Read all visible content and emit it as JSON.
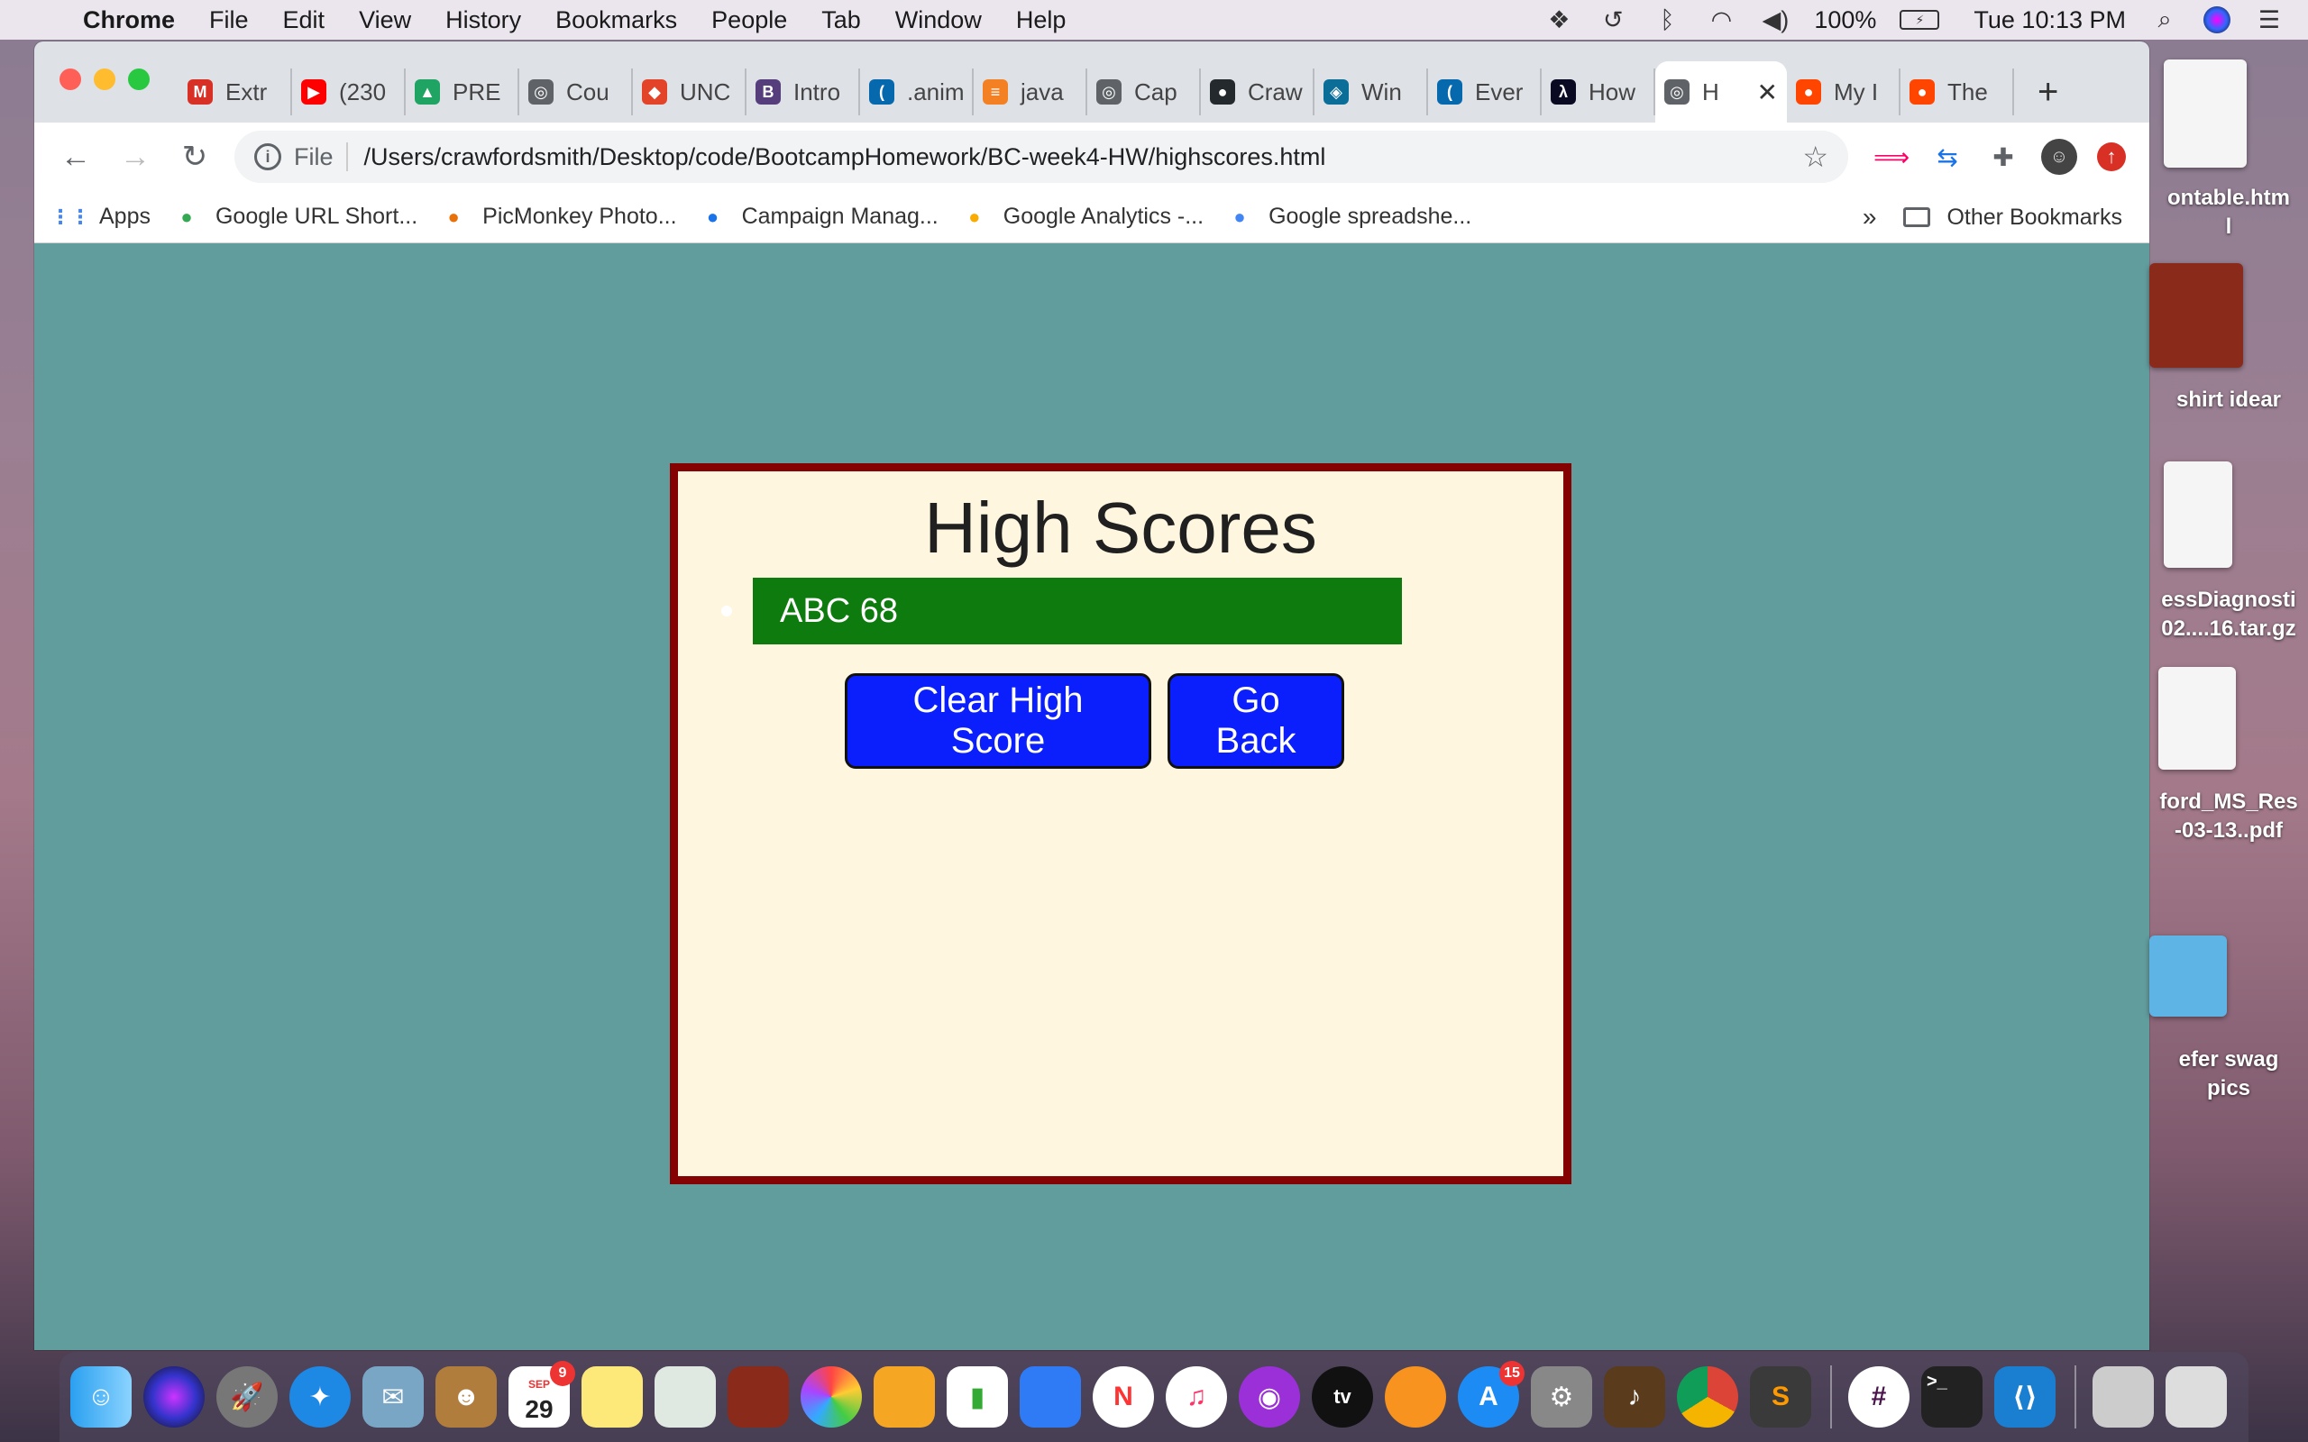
{
  "menubar": {
    "app": "Chrome",
    "items": [
      "File",
      "Edit",
      "View",
      "History",
      "Bookmarks",
      "People",
      "Tab",
      "Window",
      "Help"
    ],
    "battery": "100%",
    "clock": "Tue 10:13 PM"
  },
  "tabs": [
    {
      "label": "Extr",
      "icon": "gmail-icon",
      "color": "#d93025",
      "glyph": "M"
    },
    {
      "label": "(230",
      "icon": "youtube-icon",
      "color": "#ff0000",
      "glyph": "▶"
    },
    {
      "label": "PRE",
      "icon": "google-drive-icon",
      "color": "#1fa463",
      "glyph": "▲"
    },
    {
      "label": "Cou",
      "icon": "globe-icon",
      "color": "#5f6368",
      "glyph": "◎"
    },
    {
      "label": "UNC",
      "icon": "gitlab-icon",
      "color": "#e24329",
      "glyph": "◆"
    },
    {
      "label": "Intro",
      "icon": "bootstrap-icon",
      "color": "#563d7c",
      "glyph": "B"
    },
    {
      "label": ".anim",
      "icon": "jquery-icon",
      "color": "#0769ad",
      "glyph": "("
    },
    {
      "label": "java",
      "icon": "stackoverflow-icon",
      "color": "#f48024",
      "glyph": "≡"
    },
    {
      "label": "Cap",
      "icon": "globe-icon",
      "color": "#5f6368",
      "glyph": "◎"
    },
    {
      "label": "Craw",
      "icon": "github-icon",
      "color": "#24292e",
      "glyph": "●"
    },
    {
      "label": "Win",
      "icon": "site-icon",
      "color": "#0b6e99",
      "glyph": "◈"
    },
    {
      "label": "Ever",
      "icon": "jquery-icon",
      "color": "#0769ad",
      "glyph": "("
    },
    {
      "label": "How",
      "icon": "freecodecamp-icon",
      "color": "#0a0a23",
      "glyph": "λ"
    },
    {
      "label": "H",
      "icon": "globe-icon",
      "color": "#5f6368",
      "glyph": "◎",
      "active": true
    },
    {
      "label": "My I",
      "icon": "reddit-icon",
      "color": "#ff4500",
      "glyph": "●"
    },
    {
      "label": "The",
      "icon": "reddit-icon",
      "color": "#ff4500",
      "glyph": "●"
    }
  ],
  "address": {
    "scheme_label": "File",
    "url": "/Users/crawfordsmith/Desktop/code/BootcampHomework/BC-week4-HW/highscores.html"
  },
  "bookmarks": [
    {
      "label": "Apps",
      "icon": "apps-grid-icon"
    },
    {
      "label": "Google URL Short...",
      "icon": "url-shortener-icon"
    },
    {
      "label": "PicMonkey Photo...",
      "icon": "picmonkey-icon"
    },
    {
      "label": "Campaign Manag...",
      "icon": "google-ads-icon"
    },
    {
      "label": "Google Analytics -...",
      "icon": "analytics-icon"
    },
    {
      "label": "Google spreadshe...",
      "icon": "google-icon"
    }
  ],
  "bookmarks_more": "»",
  "other_bookmarks": "Other Bookmarks",
  "page": {
    "title": "High Scores",
    "scores": [
      "ABC 68"
    ],
    "clear_button": "Clear High Score",
    "back_button": "Go Back",
    "colors": {
      "background": "#629d9e",
      "card": "#fef6de",
      "card_border": "#850202",
      "score_row": "#0e7b0e",
      "button": "#0a1ffc"
    }
  },
  "desktop": {
    "items": [
      "ontable.htm\nl",
      "shirt idear",
      "essDiagnosti\n02....16.tar.gz",
      "ford_MS_Res\n-03-13..pdf",
      "efer swag\npics"
    ]
  },
  "dock": {
    "calendar_month": "SEP",
    "calendar_day": "29",
    "calendar_badge": "9",
    "appstore_badge": "15"
  }
}
